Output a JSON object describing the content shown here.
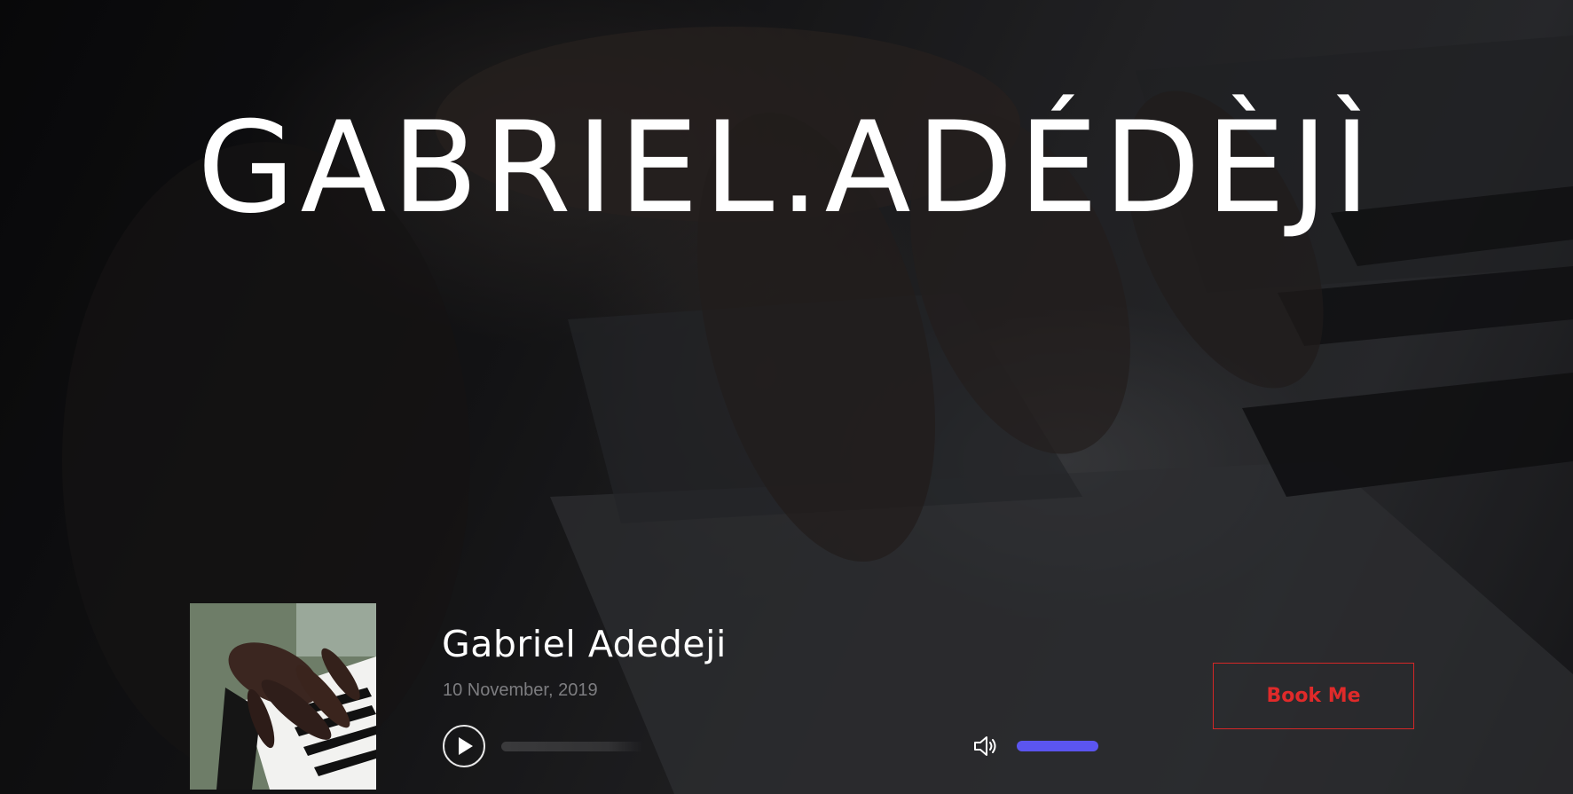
{
  "hero": {
    "title": "GABRIEL.ADÉDÈJÌ"
  },
  "player": {
    "track_title": "Gabriel Adedeji",
    "date": "10 November, 2019",
    "progress": 0.0,
    "volume": 1.0,
    "cover_alt": "Hands playing piano keys"
  },
  "actions": {
    "book_label": "Book Me"
  },
  "colors": {
    "accent_red": "#e02a2a",
    "volume_fill": "#5b55f0",
    "text_muted": "#7d7d80"
  },
  "icons": {
    "play": "play-icon",
    "volume": "volume-icon"
  }
}
